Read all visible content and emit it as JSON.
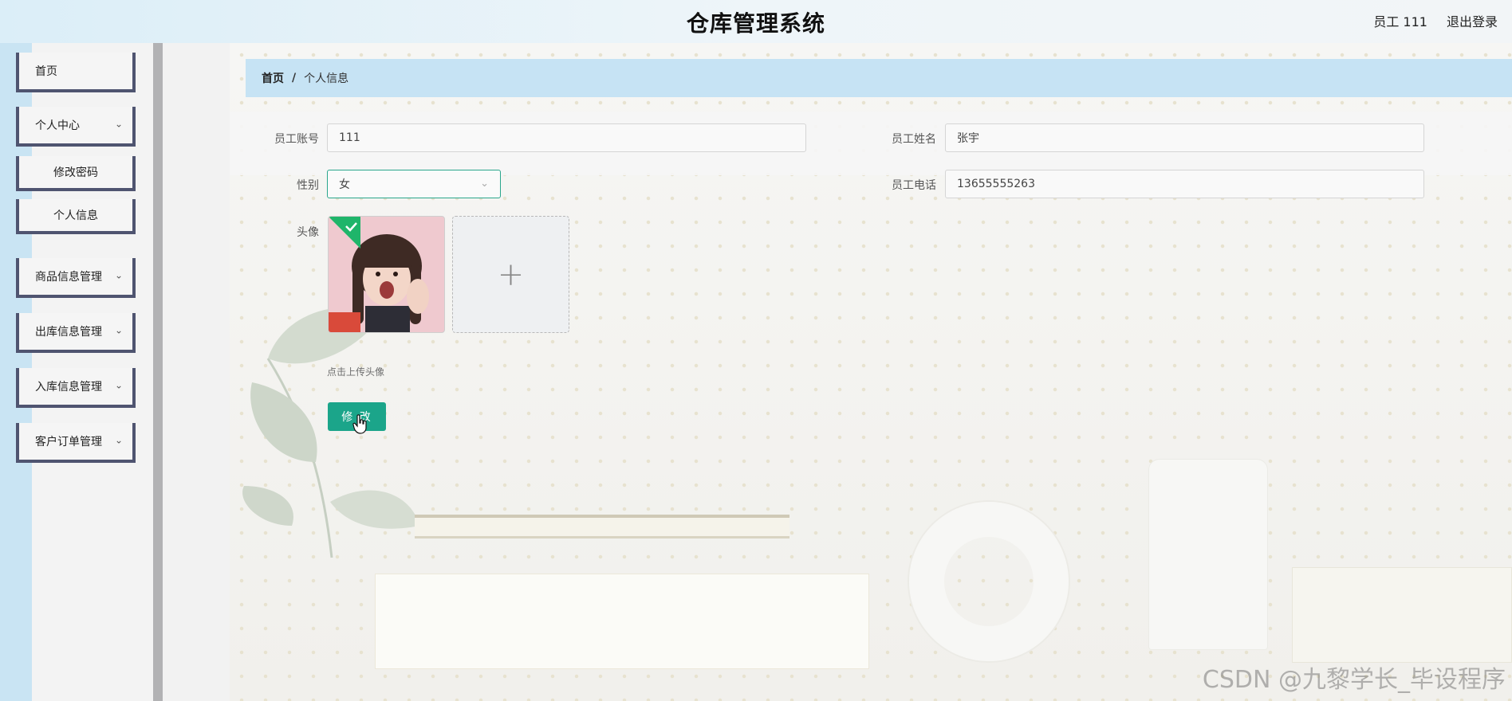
{
  "header": {
    "title": "仓库管理系统",
    "user_label": "员工 111",
    "logout_label": "退出登录"
  },
  "sidebar": {
    "items": [
      {
        "label": "首页",
        "has_chevron": false
      },
      {
        "label": "个人中心",
        "has_chevron": true
      },
      {
        "label": "修改密码",
        "has_chevron": false
      },
      {
        "label": "个人信息",
        "has_chevron": false
      },
      {
        "label": "商品信息管理",
        "has_chevron": true
      },
      {
        "label": "出库信息管理",
        "has_chevron": true
      },
      {
        "label": "入库信息管理",
        "has_chevron": true
      },
      {
        "label": "客户订单管理",
        "has_chevron": true
      }
    ]
  },
  "breadcrumb": {
    "home": "首页",
    "separator": "/",
    "current": "个人信息"
  },
  "form": {
    "account_label": "员工账号",
    "account_value": "111",
    "name_label": "员工姓名",
    "name_value": "张宇",
    "gender_label": "性别",
    "gender_value": "女",
    "phone_label": "员工电话",
    "phone_value": "13655555263",
    "avatar_label": "头像",
    "upload_plus": "+",
    "upload_hint": "点击上传头像",
    "submit_label": "修 改"
  },
  "icons": {
    "chevron": "chevron-down-icon",
    "select_arrow": "chevron-down-icon",
    "upload": "plus-icon",
    "success": "check-icon",
    "cursor": "hand-pointer-icon"
  },
  "colors": {
    "accent": "#1ba58a",
    "breadcrumb_bg": "#c6e3f4",
    "sidebar_border": "#4f5470"
  },
  "watermark": "CSDN @九黎学长_毕设程序"
}
